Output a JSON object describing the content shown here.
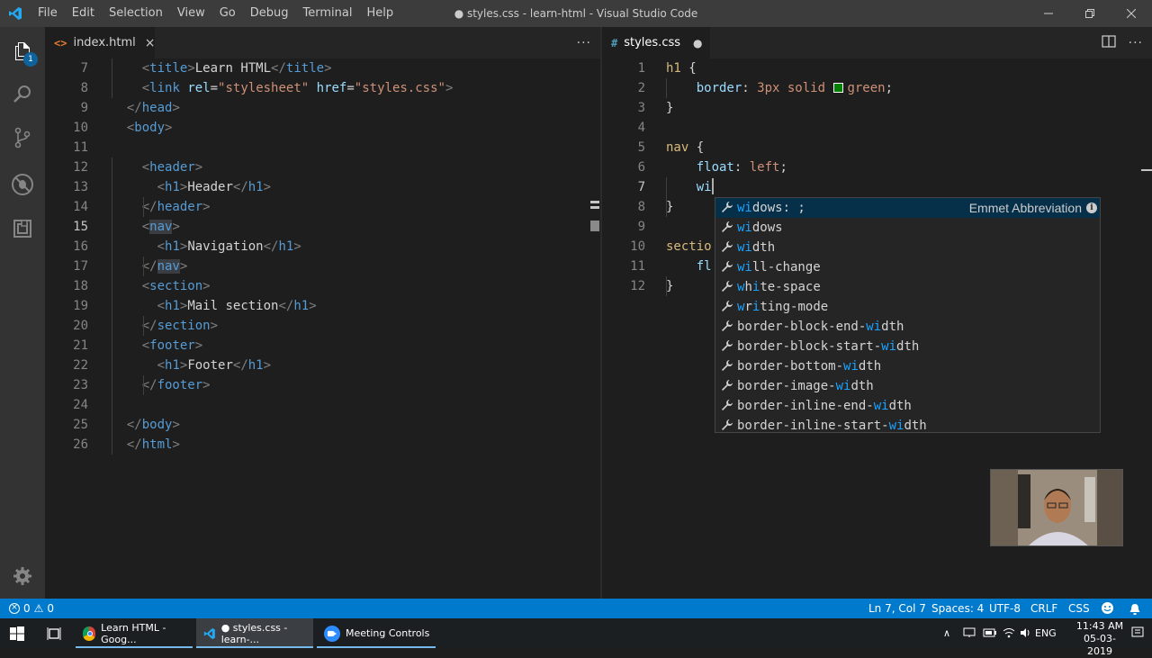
{
  "window": {
    "title": "● styles.css - learn-html - Visual Studio Code",
    "menu": [
      "File",
      "Edit",
      "Selection",
      "View",
      "Go",
      "Debug",
      "Terminal",
      "Help"
    ]
  },
  "activity_bar": {
    "icons": [
      "files-icon",
      "search-icon",
      "source-control-icon",
      "debug-icon",
      "extensions-icon",
      "settings-gear-icon"
    ],
    "explorer_badge": "1"
  },
  "left_editor": {
    "tab": {
      "label": "index.html",
      "icon": "html-file-icon",
      "close": "×"
    },
    "lines": [
      {
        "n": "7",
        "parts": [
          [
            "    ",
            "t-txt"
          ],
          [
            "<",
            "t-pun"
          ],
          [
            "title",
            "t-tag"
          ],
          [
            ">",
            "t-pun"
          ],
          [
            "Learn HTML",
            "t-txt"
          ],
          [
            "</",
            "t-pun"
          ],
          [
            "title",
            "t-tag"
          ],
          [
            ">",
            "t-pun"
          ]
        ]
      },
      {
        "n": "8",
        "parts": [
          [
            "    ",
            "t-txt"
          ],
          [
            "<",
            "t-pun"
          ],
          [
            "link",
            "t-tag"
          ],
          [
            " ",
            "t-txt"
          ],
          [
            "rel",
            "t-attr"
          ],
          [
            "=",
            "t-txt"
          ],
          [
            "\"stylesheet\"",
            "t-str"
          ],
          [
            " ",
            "t-txt"
          ],
          [
            "href",
            "t-attr"
          ],
          [
            "=",
            "t-txt"
          ],
          [
            "\"styles.css\"",
            "t-str"
          ],
          [
            ">",
            "t-pun"
          ]
        ]
      },
      {
        "n": "9",
        "parts": [
          [
            "  ",
            "t-txt"
          ],
          [
            "</",
            "t-pun"
          ],
          [
            "head",
            "t-tag"
          ],
          [
            ">",
            "t-pun"
          ]
        ]
      },
      {
        "n": "10",
        "parts": [
          [
            "  ",
            "t-txt"
          ],
          [
            "<",
            "t-pun"
          ],
          [
            "body",
            "t-tag"
          ],
          [
            ">",
            "t-pun"
          ]
        ]
      },
      {
        "n": "11",
        "parts": []
      },
      {
        "n": "12",
        "parts": [
          [
            "    ",
            "t-txt"
          ],
          [
            "<",
            "t-pun"
          ],
          [
            "header",
            "t-tag"
          ],
          [
            ">",
            "t-pun"
          ]
        ]
      },
      {
        "n": "13",
        "parts": [
          [
            "      ",
            "t-txt"
          ],
          [
            "<",
            "t-pun"
          ],
          [
            "h1",
            "t-tag"
          ],
          [
            ">",
            "t-pun"
          ],
          [
            "Header",
            "t-txt"
          ],
          [
            "</",
            "t-pun"
          ],
          [
            "h1",
            "t-tag"
          ],
          [
            ">",
            "t-pun"
          ]
        ]
      },
      {
        "n": "14",
        "parts": [
          [
            "    ",
            "t-txt"
          ],
          [
            "</",
            "t-pun"
          ],
          [
            "header",
            "t-tag"
          ],
          [
            ">",
            "t-pun"
          ]
        ]
      },
      {
        "n": "15",
        "parts": [
          [
            "    ",
            "t-txt"
          ],
          [
            "<",
            "t-pun"
          ],
          [
            "nav",
            "t-tag t-hl"
          ],
          [
            ">",
            "t-pun"
          ]
        ],
        "current": true
      },
      {
        "n": "16",
        "parts": [
          [
            "      ",
            "t-txt"
          ],
          [
            "<",
            "t-pun"
          ],
          [
            "h1",
            "t-tag"
          ],
          [
            ">",
            "t-pun"
          ],
          [
            "Navigation",
            "t-txt"
          ],
          [
            "</",
            "t-pun"
          ],
          [
            "h1",
            "t-tag"
          ],
          [
            ">",
            "t-pun"
          ]
        ]
      },
      {
        "n": "17",
        "parts": [
          [
            "    ",
            "t-txt"
          ],
          [
            "</",
            "t-pun"
          ],
          [
            "nav",
            "t-tag t-hl"
          ],
          [
            ">",
            "t-pun"
          ]
        ]
      },
      {
        "n": "18",
        "parts": [
          [
            "    ",
            "t-txt"
          ],
          [
            "<",
            "t-pun"
          ],
          [
            "section",
            "t-tag"
          ],
          [
            ">",
            "t-pun"
          ]
        ]
      },
      {
        "n": "19",
        "parts": [
          [
            "      ",
            "t-txt"
          ],
          [
            "<",
            "t-pun"
          ],
          [
            "h1",
            "t-tag"
          ],
          [
            ">",
            "t-pun"
          ],
          [
            "Mail section",
            "t-txt"
          ],
          [
            "</",
            "t-pun"
          ],
          [
            "h1",
            "t-tag"
          ],
          [
            ">",
            "t-pun"
          ]
        ]
      },
      {
        "n": "20",
        "parts": [
          [
            "    ",
            "t-txt"
          ],
          [
            "</",
            "t-pun"
          ],
          [
            "section",
            "t-tag"
          ],
          [
            ">",
            "t-pun"
          ]
        ]
      },
      {
        "n": "21",
        "parts": [
          [
            "    ",
            "t-txt"
          ],
          [
            "<",
            "t-pun"
          ],
          [
            "footer",
            "t-tag"
          ],
          [
            ">",
            "t-pun"
          ]
        ]
      },
      {
        "n": "22",
        "parts": [
          [
            "      ",
            "t-txt"
          ],
          [
            "<",
            "t-pun"
          ],
          [
            "h1",
            "t-tag"
          ],
          [
            ">",
            "t-pun"
          ],
          [
            "Footer",
            "t-txt"
          ],
          [
            "</",
            "t-pun"
          ],
          [
            "h1",
            "t-tag"
          ],
          [
            ">",
            "t-pun"
          ]
        ]
      },
      {
        "n": "23",
        "parts": [
          [
            "    ",
            "t-txt"
          ],
          [
            "</",
            "t-pun"
          ],
          [
            "footer",
            "t-tag"
          ],
          [
            ">",
            "t-pun"
          ]
        ]
      },
      {
        "n": "24",
        "parts": []
      },
      {
        "n": "25",
        "parts": [
          [
            "  ",
            "t-txt"
          ],
          [
            "</",
            "t-pun"
          ],
          [
            "body",
            "t-tag"
          ],
          [
            ">",
            "t-pun"
          ]
        ]
      },
      {
        "n": "26",
        "parts": [
          [
            "  ",
            "t-txt"
          ],
          [
            "</",
            "t-pun"
          ],
          [
            "html",
            "t-tag"
          ],
          [
            ">",
            "t-pun"
          ]
        ]
      }
    ]
  },
  "right_editor": {
    "tab": {
      "label": "styles.css",
      "icon": "css-file-icon",
      "dirty": "●"
    },
    "lines": [
      {
        "n": "1",
        "parts": [
          [
            "h1",
            "t-sel"
          ],
          [
            " {",
            "t-txt"
          ]
        ]
      },
      {
        "n": "2",
        "parts": [
          [
            "    ",
            "t-txt"
          ],
          [
            "border",
            "t-prop"
          ],
          [
            ": ",
            "t-txt"
          ],
          [
            "3px solid ",
            "t-val"
          ],
          [
            "SWATCH",
            "t-txt"
          ],
          [
            "green",
            "t-val"
          ],
          [
            ";",
            "t-txt"
          ]
        ]
      },
      {
        "n": "3",
        "parts": [
          [
            "}",
            "t-txt"
          ]
        ]
      },
      {
        "n": "4",
        "parts": []
      },
      {
        "n": "5",
        "parts": [
          [
            "nav",
            "t-sel"
          ],
          [
            " {",
            "t-txt"
          ]
        ]
      },
      {
        "n": "6",
        "parts": [
          [
            "    ",
            "t-txt"
          ],
          [
            "float",
            "t-prop"
          ],
          [
            ": ",
            "t-txt"
          ],
          [
            "left",
            "t-val"
          ],
          [
            ";",
            "t-txt"
          ]
        ]
      },
      {
        "n": "7",
        "parts": [
          [
            "    ",
            "t-txt"
          ],
          [
            "wi",
            "t-prop"
          ]
        ],
        "current": true
      },
      {
        "n": "8",
        "parts": [
          [
            "}",
            "t-txt"
          ]
        ]
      },
      {
        "n": "9",
        "parts": []
      },
      {
        "n": "10",
        "parts": [
          [
            "sectio",
            "t-sel"
          ]
        ]
      },
      {
        "n": "11",
        "parts": [
          [
            "    ",
            "t-txt"
          ],
          [
            "fl",
            "t-prop"
          ]
        ]
      },
      {
        "n": "12",
        "parts": [
          [
            "}",
            "t-txt"
          ]
        ]
      }
    ],
    "swatch_color": "#008000"
  },
  "suggestions": {
    "detail": "Emmet Abbreviation",
    "items": [
      {
        "pre": "",
        "m": "wi",
        "post": "dows: ;"
      },
      {
        "pre": "",
        "m": "wi",
        "post": "dows"
      },
      {
        "pre": "",
        "m": "wi",
        "post": "dth"
      },
      {
        "pre": "",
        "m": "wi",
        "post": "ll-change"
      },
      {
        "pre": "",
        "m": "w",
        "mid": "h",
        "m2": "i",
        "post": "te-space",
        "special": "white"
      },
      {
        "pre": "",
        "m": "w",
        "mid": "r",
        "m2": "i",
        "post": "ting-mode",
        "special": "writing"
      },
      {
        "pre": "border-block-end-",
        "m": "wi",
        "post": "dth"
      },
      {
        "pre": "border-block-start-",
        "m": "wi",
        "post": "dth"
      },
      {
        "pre": "border-bottom-",
        "m": "wi",
        "post": "dth"
      },
      {
        "pre": "border-image-",
        "m": "wi",
        "post": "dth"
      },
      {
        "pre": "border-inline-end-",
        "m": "wi",
        "post": "dth"
      },
      {
        "pre": "border-inline-start-",
        "m": "wi",
        "post": "dth"
      }
    ]
  },
  "status_bar": {
    "errors": "0",
    "warnings": "0",
    "position": "Ln 7, Col 7",
    "spaces": "Spaces: 4",
    "encoding": "UTF-8",
    "eol": "CRLF",
    "language": "CSS"
  },
  "taskbar": {
    "apps": [
      {
        "label": "Learn HTML - Goog...",
        "icon": "chrome-icon"
      },
      {
        "label": "● styles.css - learn-...",
        "icon": "vscode-icon"
      },
      {
        "label": "Meeting Controls",
        "icon": "zoom-icon"
      }
    ],
    "lang": "ENG",
    "time": "11:43 AM",
    "date": "05-03-2019"
  },
  "colors": {
    "statusbar": "#007acc",
    "accent": "#0e639c"
  }
}
